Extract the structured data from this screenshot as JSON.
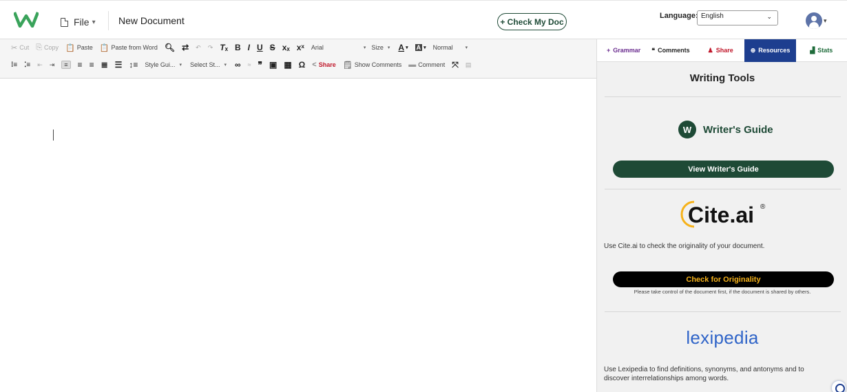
{
  "header": {
    "file_label": "File",
    "caret": "▾",
    "doc_title": "New Document",
    "check_button": "+ Check My Doc",
    "language_label": "Language:",
    "language_value": "English",
    "avatar_caret": "▾"
  },
  "toolbar": {
    "row1": {
      "cut": "Cut",
      "copy": "Copy",
      "paste": "Paste",
      "paste_word": "Paste from Word",
      "font_name": "Arial",
      "font_size": "Size",
      "format": "Normal"
    },
    "row2": {
      "style_guide": "Style Gui...",
      "select_style": "Select St...",
      "share": "Share",
      "show_comments": "Show Comments",
      "comment": "Comment"
    }
  },
  "panel": {
    "tabs": {
      "grammar": "Grammar",
      "comments": "Comments",
      "share": "Share",
      "resources": "Resources",
      "stats": "Stats"
    },
    "title": "Writing Tools",
    "writers_guide": {
      "name": "Writer's Guide",
      "button": "View Writer's Guide"
    },
    "cite": {
      "logo_text": "Cite.ai",
      "description": "Use Cite.ai to check the originality of your document.",
      "button": "Check for Originality",
      "note": "Please take control of the document first, if the document is shared by others."
    },
    "lexipedia": {
      "logo_text": "lexipedia",
      "description": "Use Lexipedia to find definitions, synonyms, and antonyms and to discover interrelationships among words."
    }
  },
  "colors": {
    "brand_green": "#1e4a36",
    "resources_tab": "#1d3e8f",
    "share_red": "#c0172a",
    "cite_gold": "#f6b21a",
    "lexipedia_blue": "#2f64c8"
  }
}
